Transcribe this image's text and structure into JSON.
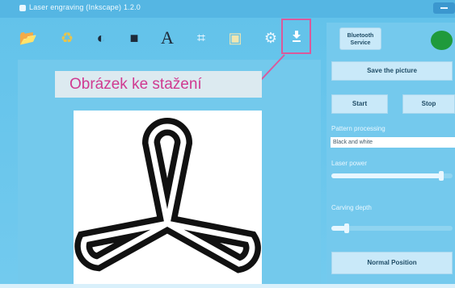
{
  "window": {
    "title": "Laser engraving (Inkscape) 1.2.0"
  },
  "toolbar": {
    "buttons": [
      {
        "icon": "folder-icon",
        "glyph": "📂"
      },
      {
        "icon": "recycle-icon",
        "glyph": "♻"
      },
      {
        "icon": "shape-icon",
        "glyph": "◐"
      },
      {
        "icon": "image-icon",
        "glyph": "■"
      },
      {
        "icon": "text-icon",
        "glyph": "A"
      },
      {
        "icon": "crop-icon",
        "glyph": "⌗"
      },
      {
        "icon": "save-icon",
        "glyph": "▣"
      },
      {
        "icon": "gear-icon",
        "glyph": "⚙"
      }
    ],
    "download_icon": "download-icon"
  },
  "callout": {
    "text": "Obrázek ke stažení"
  },
  "panel": {
    "brand_label_line1": "Bluetooth",
    "brand_label_line2": "Service",
    "save_button": "Save the picture",
    "start_button": "Start",
    "stop_button": "Stop",
    "pattern_label": "Pattern processing",
    "pattern_value": "Black and white",
    "laser_power_label": "Laser power",
    "laser_power_level": 0.9,
    "carving_depth_label": "Carving depth",
    "carving_depth_level": 0.12,
    "normal_button": "Normal Position"
  },
  "colors": {
    "accent": "#d95a9c",
    "window_bg": "#6cc6ec",
    "status": "#1f9a3c"
  }
}
